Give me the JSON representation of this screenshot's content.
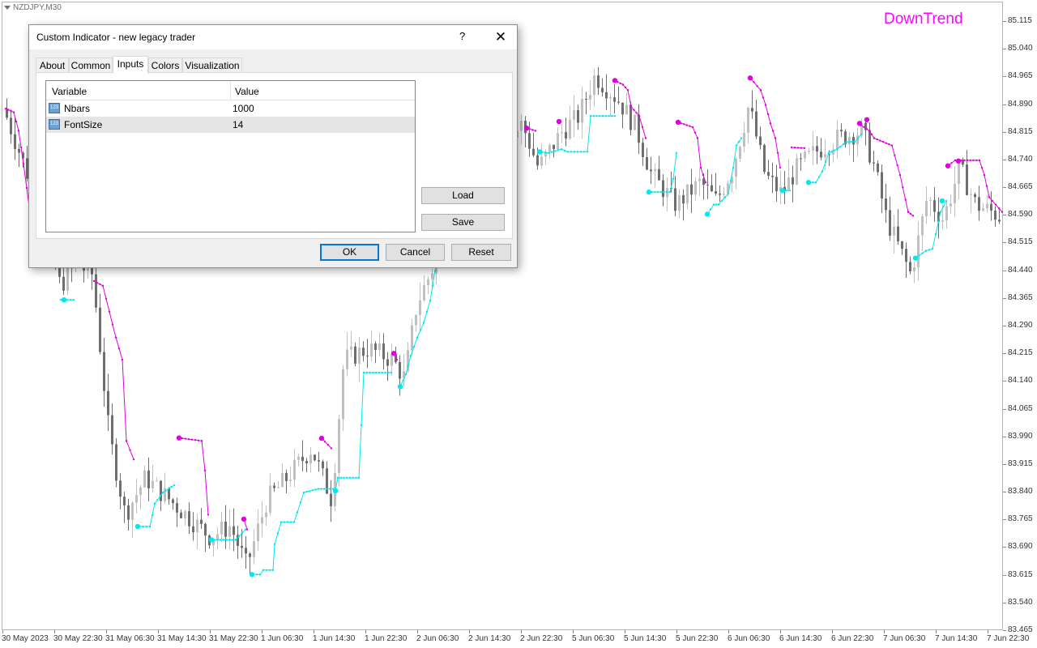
{
  "chart": {
    "symbol": "NZDJPY,M30",
    "trend_label": "DownTrend",
    "colors": {
      "bull_candle": "#c0c0c0",
      "bear_candle": "#6e6e6e",
      "up_line": "#00e8f0",
      "down_line": "#e000e0"
    },
    "price_axis": [
      "85.115",
      "85.040",
      "84.965",
      "84.890",
      "84.815",
      "84.740",
      "84.665",
      "84.590",
      "84.515",
      "84.440",
      "84.365",
      "84.290",
      "84.215",
      "84.140",
      "84.065",
      "83.990",
      "83.915",
      "83.840",
      "83.765",
      "83.690",
      "83.615",
      "83.540",
      "83.465"
    ],
    "time_axis": [
      "30 May 2023",
      "30 May 22:30",
      "31 May 06:30",
      "31 May 14:30",
      "31 May 22:30",
      "1 Jun 06:30",
      "1 Jun 14:30",
      "1 Jun 22:30",
      "2 Jun 06:30",
      "2 Jun 14:30",
      "2 Jun 22:30",
      "5 Jun 06:30",
      "5 Jun 14:30",
      "5 Jun 22:30",
      "6 Jun 06:30",
      "6 Jun 14:30",
      "6 Jun 22:30",
      "7 Jun 06:30",
      "7 Jun 14:30",
      "7 Jun 22:30"
    ],
    "price_path": [
      [
        0,
        84.88
      ],
      [
        40,
        84.64
      ],
      [
        70,
        84.4
      ],
      [
        90,
        84.46
      ],
      [
        110,
        84.43
      ],
      [
        130,
        84.0
      ],
      [
        150,
        83.78
      ],
      [
        175,
        83.88
      ],
      [
        205,
        83.82
      ],
      [
        230,
        83.77
      ],
      [
        255,
        83.72
      ],
      [
        280,
        83.75
      ],
      [
        300,
        83.64
      ],
      [
        325,
        83.82
      ],
      [
        350,
        83.88
      ],
      [
        380,
        83.96
      ],
      [
        405,
        83.82
      ],
      [
        420,
        84.2
      ],
      [
        450,
        84.23
      ],
      [
        480,
        84.2
      ],
      [
        495,
        84.15
      ],
      [
        510,
        84.35
      ],
      [
        530,
        84.45
      ],
      [
        560,
        84.6
      ],
      [
        600,
        84.72
      ],
      [
        640,
        84.84
      ],
      [
        660,
        84.72
      ],
      [
        690,
        84.82
      ],
      [
        710,
        84.86
      ],
      [
        730,
        84.97
      ],
      [
        760,
        84.9
      ],
      [
        780,
        84.83
      ],
      [
        800,
        84.7
      ],
      [
        830,
        84.62
      ],
      [
        860,
        84.68
      ],
      [
        880,
        84.63
      ],
      [
        900,
        84.72
      ],
      [
        920,
        84.89
      ],
      [
        940,
        84.7
      ],
      [
        960,
        84.65
      ],
      [
        980,
        84.72
      ],
      [
        1000,
        84.76
      ],
      [
        1030,
        84.8
      ],
      [
        1060,
        84.82
      ],
      [
        1075,
        84.72
      ],
      [
        1090,
        84.58
      ],
      [
        1110,
        84.48
      ],
      [
        1120,
        84.43
      ],
      [
        1140,
        84.64
      ],
      [
        1160,
        84.58
      ],
      [
        1180,
        84.72
      ],
      [
        1200,
        84.62
      ],
      [
        1220,
        84.6
      ],
      [
        1236,
        84.58
      ]
    ],
    "up_line": [
      [
        [
          72,
          84.362
        ],
        [
          88,
          84.362
        ]
      ],
      [
        [
          165,
          83.748
        ],
        [
          182,
          83.748
        ],
        [
          188,
          83.81
        ],
        [
          198,
          83.84
        ],
        [
          212,
          83.86
        ]
      ],
      [
        [
          258,
          83.712
        ],
        [
          288,
          83.712
        ],
        [
          300,
          83.74
        ]
      ],
      [
        [
          306,
          83.618
        ],
        [
          318,
          83.618
        ],
        [
          322,
          83.63
        ],
        [
          334,
          83.63
        ],
        [
          336,
          83.7
        ],
        [
          344,
          83.76
        ],
        [
          360,
          83.76
        ],
        [
          372,
          83.84
        ],
        [
          390,
          83.85
        ],
        [
          408,
          83.85
        ]
      ],
      [
        [
          411,
          83.845
        ],
        [
          414,
          83.88
        ],
        [
          440,
          83.88
        ],
        [
          446,
          84.165
        ],
        [
          480,
          84.165
        ]
      ],
      [
        [
          491,
          84.127
        ],
        [
          498,
          84.16
        ],
        [
          504,
          84.21
        ],
        [
          512,
          84.26
        ],
        [
          520,
          84.3
        ],
        [
          528,
          84.36
        ],
        [
          534,
          84.44
        ],
        [
          542,
          84.52
        ]
      ],
      [
        [
          662,
          84.763
        ],
        [
          674,
          84.76
        ],
        [
          690,
          84.77
        ],
        [
          698,
          84.763
        ],
        [
          722,
          84.763
        ],
        [
          726,
          84.86
        ],
        [
          756,
          84.86
        ]
      ],
      [
        [
          798,
          84.654
        ],
        [
          824,
          84.654
        ],
        [
          828,
          84.69
        ],
        [
          832,
          84.76
        ]
      ],
      [
        [
          870,
          84.594
        ],
        [
          878,
          84.62
        ],
        [
          884,
          84.62
        ],
        [
          896,
          84.65
        ],
        [
          902,
          84.72
        ],
        [
          906,
          84.78
        ],
        [
          912,
          84.8
        ]
      ],
      [
        [
          963,
          84.658
        ],
        [
          972,
          84.658
        ]
      ],
      [
        [
          994,
          84.68
        ],
        [
          1004,
          84.68
        ],
        [
          1012,
          84.71
        ],
        [
          1020,
          84.76
        ],
        [
          1030,
          84.77
        ],
        [
          1042,
          84.79
        ],
        [
          1052,
          84.79
        ],
        [
          1060,
          84.81
        ]
      ],
      [
        [
          1127,
          84.475
        ],
        [
          1140,
          84.495
        ],
        [
          1148,
          84.5
        ],
        [
          1152,
          84.54
        ],
        [
          1158,
          84.6
        ],
        [
          1165,
          84.63
        ]
      ]
    ],
    "down_line": [
      [
        [
          4,
          84.88
        ],
        [
          14,
          84.87
        ],
        [
          20,
          84.82
        ],
        [
          26,
          84.73
        ],
        [
          34,
          84.6
        ]
      ],
      [
        [
          113,
          84.413
        ],
        [
          124,
          84.4
        ],
        [
          132,
          84.33
        ],
        [
          140,
          84.26
        ],
        [
          148,
          84.2
        ],
        [
          153,
          83.98
        ],
        [
          162,
          83.93
        ]
      ],
      [
        [
          218,
          83.988
        ],
        [
          246,
          83.98
        ],
        [
          250,
          83.9
        ],
        [
          254,
          83.78
        ]
      ],
      [
        [
          298,
          83.768
        ],
        [
          302,
          83.74
        ]
      ],
      [
        [
          394,
          83.987
        ],
        [
          406,
          83.96
        ]
      ],
      [
        [
          483,
          84.217
        ],
        [
          487,
          84.2
        ]
      ],
      [
        [
          647,
          84.827
        ],
        [
          658,
          84.82
        ]
      ],
      [
        [
          756,
          84.956
        ],
        [
          766,
          84.945
        ],
        [
          772,
          84.93
        ],
        [
          776,
          84.885
        ],
        [
          786,
          84.86
        ],
        [
          794,
          84.8
        ]
      ],
      [
        [
          834,
          84.843
        ],
        [
          852,
          84.83
        ],
        [
          858,
          84.8
        ],
        [
          862,
          84.72
        ],
        [
          868,
          84.68
        ]
      ],
      [
        [
          923,
          84.963
        ],
        [
          936,
          84.93
        ],
        [
          942,
          84.89
        ],
        [
          948,
          84.84
        ],
        [
          954,
          84.8
        ],
        [
          960,
          84.72
        ]
      ],
      [
        [
          974,
          84.775
        ],
        [
          990,
          84.773
        ]
      ],
      [
        [
          1060,
          84.835
        ],
        [
          1070,
          84.82
        ],
        [
          1076,
          84.8
        ],
        [
          1098,
          84.78
        ],
        [
          1108,
          84.7
        ],
        [
          1118,
          84.6
        ],
        [
          1124,
          84.59
        ]
      ],
      [
        [
          1167,
          84.725
        ],
        [
          1176,
          84.74
        ],
        [
          1206,
          84.74
        ],
        [
          1212,
          84.7
        ],
        [
          1218,
          84.64
        ],
        [
          1234,
          84.6
        ]
      ]
    ],
    "up_dots": [
      [
        76,
        84.362
      ],
      [
        167,
        83.748
      ],
      [
        258,
        83.712
      ],
      [
        308,
        83.618
      ],
      [
        411,
        83.845
      ],
      [
        491,
        84.127
      ],
      [
        663,
        84.763
      ],
      [
        798,
        84.654
      ],
      [
        870,
        84.594
      ],
      [
        963,
        84.658
      ],
      [
        995,
        84.68
      ],
      [
        1127,
        84.475
      ],
      [
        1160,
        84.63
      ]
    ],
    "down_dots": [
      [
        218,
        83.988
      ],
      [
        298,
        83.768
      ],
      [
        394,
        83.987
      ],
      [
        483,
        84.217
      ],
      [
        647,
        84.827
      ],
      [
        687,
        84.845
      ],
      [
        756,
        84.956
      ],
      [
        834,
        84.843
      ],
      [
        923,
        84.963
      ],
      [
        1058,
        84.84
      ],
      [
        1067,
        84.85
      ],
      [
        1167,
        84.725
      ],
      [
        1180,
        84.738
      ]
    ]
  },
  "dialog": {
    "title": "Custom Indicator - new legacy trader",
    "help": "?",
    "close": "✕",
    "tabs": [
      "About",
      "Common",
      "Inputs",
      "Colors",
      "Visualization"
    ],
    "active_tab": "Inputs",
    "grid": {
      "headers": {
        "variable": "Variable",
        "value": "Value"
      },
      "rows": [
        {
          "icon": "123",
          "name": "Nbars",
          "value": "1000"
        },
        {
          "icon": "123",
          "name": "FontSize",
          "value": "14"
        }
      ]
    },
    "buttons": {
      "load": "Load",
      "save": "Save",
      "ok": "OK",
      "cancel": "Cancel",
      "reset": "Reset"
    }
  }
}
